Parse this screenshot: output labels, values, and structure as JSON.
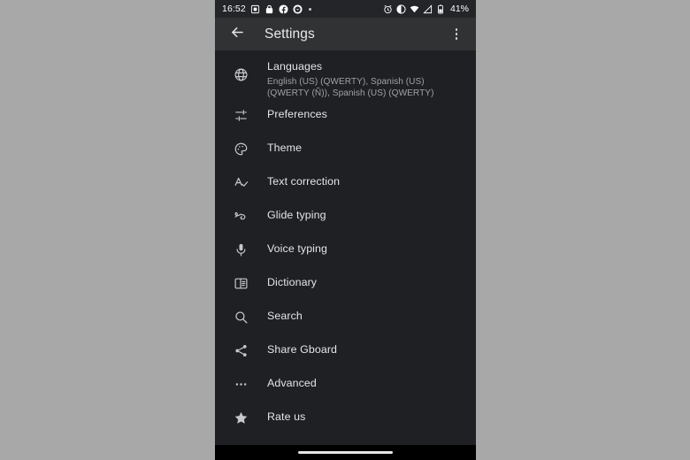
{
  "status_bar": {
    "clock": "16:52",
    "battery_percent": "41%",
    "left_icons": [
      {
        "name": "screenshot-icon"
      },
      {
        "name": "vpn-key-icon"
      },
      {
        "name": "facebook-icon"
      },
      {
        "name": "facebook-messenger-icon"
      },
      {
        "name": "more-notifications-dot"
      }
    ],
    "right_icons": [
      {
        "name": "alarm-icon"
      },
      {
        "name": "do-not-disturb-icon"
      },
      {
        "name": "wifi-icon"
      },
      {
        "name": "signal-icon"
      },
      {
        "name": "battery-icon"
      }
    ]
  },
  "app_bar": {
    "back_label": "Back",
    "title": "Settings",
    "overflow_label": "More options"
  },
  "settings": {
    "items": [
      {
        "icon": "language-globe-icon",
        "title": "Languages",
        "subtitle": "English (US) (QWERTY), Spanish (US) (QWERTY (Ñ)), Spanish (US) (QWERTY)"
      },
      {
        "icon": "tune-sliders-icon",
        "title": "Preferences",
        "subtitle": ""
      },
      {
        "icon": "palette-icon",
        "title": "Theme",
        "subtitle": ""
      },
      {
        "icon": "spellcheck-icon",
        "title": "Text correction",
        "subtitle": ""
      },
      {
        "icon": "gesture-glide-icon",
        "title": "Glide typing",
        "subtitle": ""
      },
      {
        "icon": "microphone-icon",
        "title": "Voice typing",
        "subtitle": ""
      },
      {
        "icon": "dictionary-book-icon",
        "title": "Dictionary",
        "subtitle": ""
      },
      {
        "icon": "search-icon",
        "title": "Search",
        "subtitle": ""
      },
      {
        "icon": "share-icon",
        "title": "Share Gboard",
        "subtitle": ""
      },
      {
        "icon": "more-horizontal-icon",
        "title": "Advanced",
        "subtitle": ""
      },
      {
        "icon": "star-icon",
        "title": "Rate us",
        "subtitle": ""
      }
    ]
  },
  "nav_bar": {
    "home_indicator_label": "Home"
  },
  "colors": {
    "page_background": "#a8a8a8",
    "screen_background": "#1e2023",
    "app_bar_background": "#303234",
    "status_bar_background": "#232528",
    "primary_text": "#e3e5e7",
    "secondary_text": "#9fa2a5",
    "icon_color": "#c6c8ca",
    "nav_bar_background": "#000000"
  }
}
